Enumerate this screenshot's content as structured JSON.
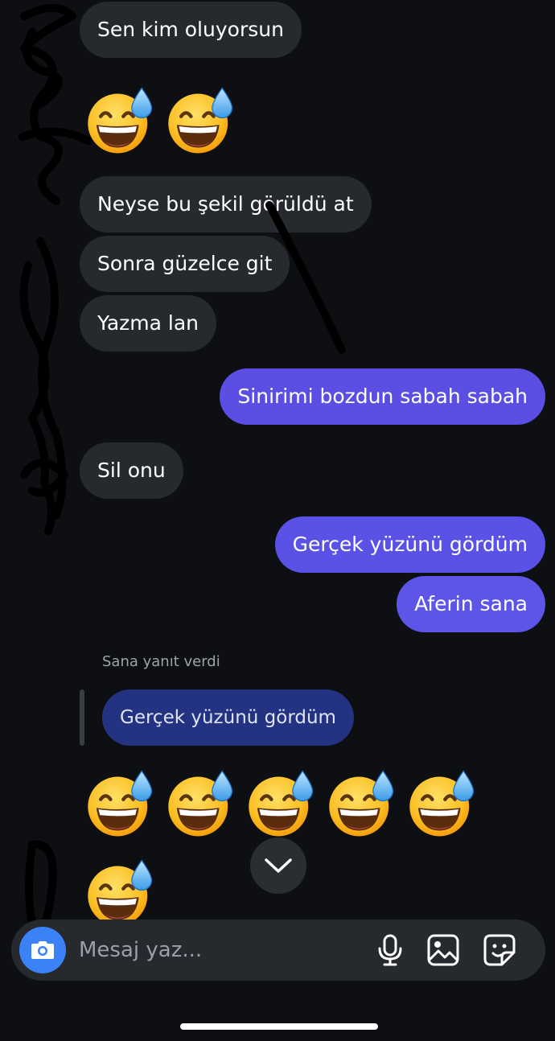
{
  "messages": {
    "m1": "Sen kim oluyorsun",
    "m2": "Neyse bu şekil görüldü at",
    "m3": "Sonra güzelce git",
    "m4": "Yazma lan",
    "m5": "Sinirimi bozdun sabah sabah",
    "m6": "Sil onu",
    "m7": "Gerçek yüzünü gördüm",
    "m8": "Aferin sana"
  },
  "reply": {
    "label": "Sana yanıt verdi",
    "quoted": "Gerçek yüzünü gördüm"
  },
  "emoji": {
    "name": "grinning-face-with-sweat",
    "row1_count": 2,
    "row2_count": 5,
    "row3_count": 1
  },
  "composer": {
    "placeholder": "Mesaj yaz..."
  },
  "colors": {
    "background": "#0d0f13",
    "incoming_bubble": "#26292e",
    "outgoing_bubble": "#5b4fe3",
    "quoted_bubble": "#233382",
    "camera_button": "#3b82f6"
  },
  "icons": [
    "camera-icon",
    "microphone-icon",
    "image-icon",
    "sticker-icon",
    "chevron-down-icon"
  ]
}
